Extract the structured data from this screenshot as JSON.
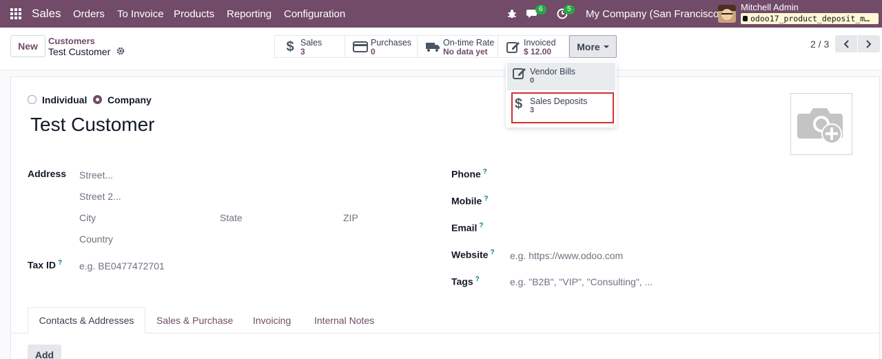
{
  "navbar": {
    "app_name": "Sales",
    "menu": [
      "Orders",
      "To Invoice",
      "Products",
      "Reporting",
      "Configuration"
    ],
    "chat_badge": "6",
    "activity_badge": "5",
    "company": "My Company (San Francisco)",
    "user_name": "Mitchell Admin",
    "db_name": "odoo17_product_deposit_m…"
  },
  "control_panel": {
    "new_label": "New",
    "breadcrumb_parent": "Customers",
    "breadcrumb_current": "Test Customer",
    "smart_buttons": [
      {
        "label": "Sales",
        "value": "3",
        "icon": "dollar-icon"
      },
      {
        "label": "Purchases",
        "value": "0",
        "icon": "credit-card-icon"
      },
      {
        "label": "On-time Rate",
        "value": "No data yet",
        "icon": "truck-icon"
      },
      {
        "label": "Invoiced",
        "value": "$ 12.00",
        "icon": "edit-icon"
      }
    ],
    "more_label": "More",
    "pager": "2 / 3"
  },
  "dropdown": {
    "items": [
      {
        "label": "Vendor Bills",
        "value": "0",
        "icon": "edit-icon"
      },
      {
        "label": "Sales Deposits",
        "value": "3",
        "icon": "dollar-icon"
      }
    ]
  },
  "form": {
    "company_type": {
      "options": [
        "Individual",
        "Company"
      ],
      "selected": "Company"
    },
    "name": "Test Customer",
    "address_label": "Address",
    "street_placeholder": "Street...",
    "street2_placeholder": "Street 2...",
    "city_placeholder": "City",
    "state_placeholder": "State",
    "zip_placeholder": "ZIP",
    "country_placeholder": "Country",
    "tax_id_label": "Tax ID",
    "tax_id_placeholder": "e.g. BE0477472701",
    "phone_label": "Phone",
    "mobile_label": "Mobile",
    "email_label": "Email",
    "website_label": "Website",
    "website_placeholder": "e.g. https://www.odoo.com",
    "tags_label": "Tags",
    "tags_placeholder": "e.g. \"B2B\", \"VIP\", \"Consulting\", ...",
    "help_mark": "?"
  },
  "tabs": [
    "Contacts & Addresses",
    "Sales & Purchase",
    "Invoicing",
    "Internal Notes"
  ],
  "add_label": "Add",
  "colors": {
    "brand": "#714b67",
    "badge": "#28a745",
    "highlight": "#d32f2f"
  }
}
